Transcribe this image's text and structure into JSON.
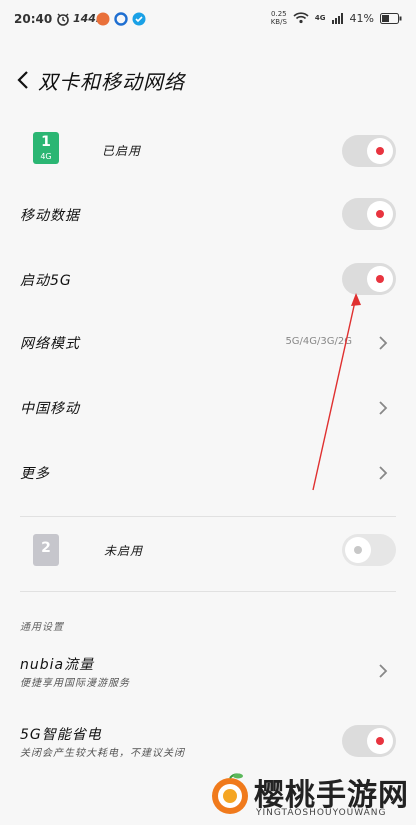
{
  "status_bar": {
    "time": "20:40",
    "speed": "144",
    "speed_unit": "Hz",
    "net_speed": "0.25",
    "net_unit": "KB/S",
    "signal_type": "4G",
    "battery": "41%"
  },
  "header": {
    "title": "双卡和移动网络",
    "back_icon": "chevron-left-icon"
  },
  "sim1": {
    "number": "1",
    "network": "4G",
    "status": "已启用",
    "enabled": true,
    "color": "#2bb673"
  },
  "rows": {
    "mobile_data": {
      "label": "移动数据",
      "on": true
    },
    "enable_5g": {
      "label": "启动5G",
      "on": true
    },
    "network_mode": {
      "label": "网络模式",
      "value": "5G/4G/3G/2G"
    },
    "carrier": {
      "label": "中国移动"
    },
    "more": {
      "label": "更多"
    }
  },
  "sim2": {
    "number": "2",
    "status": "未启用",
    "enabled": false,
    "color": "#c6c6cc"
  },
  "general": {
    "section_title": "通用设置",
    "nubia_traffic": {
      "label": "nubia流量",
      "sub": "便捷享用国际漫游服务"
    },
    "power_5g": {
      "label": "5G智能省电",
      "sub": "关闭会产生较大耗电，不建议关闭",
      "on": true
    }
  },
  "watermark": {
    "name": "樱桃手游网",
    "sub": "YINGTAOSHOUYOUWANG"
  },
  "colors": {
    "accent": "#e8343f",
    "annotation_arrow": "#e03030"
  }
}
